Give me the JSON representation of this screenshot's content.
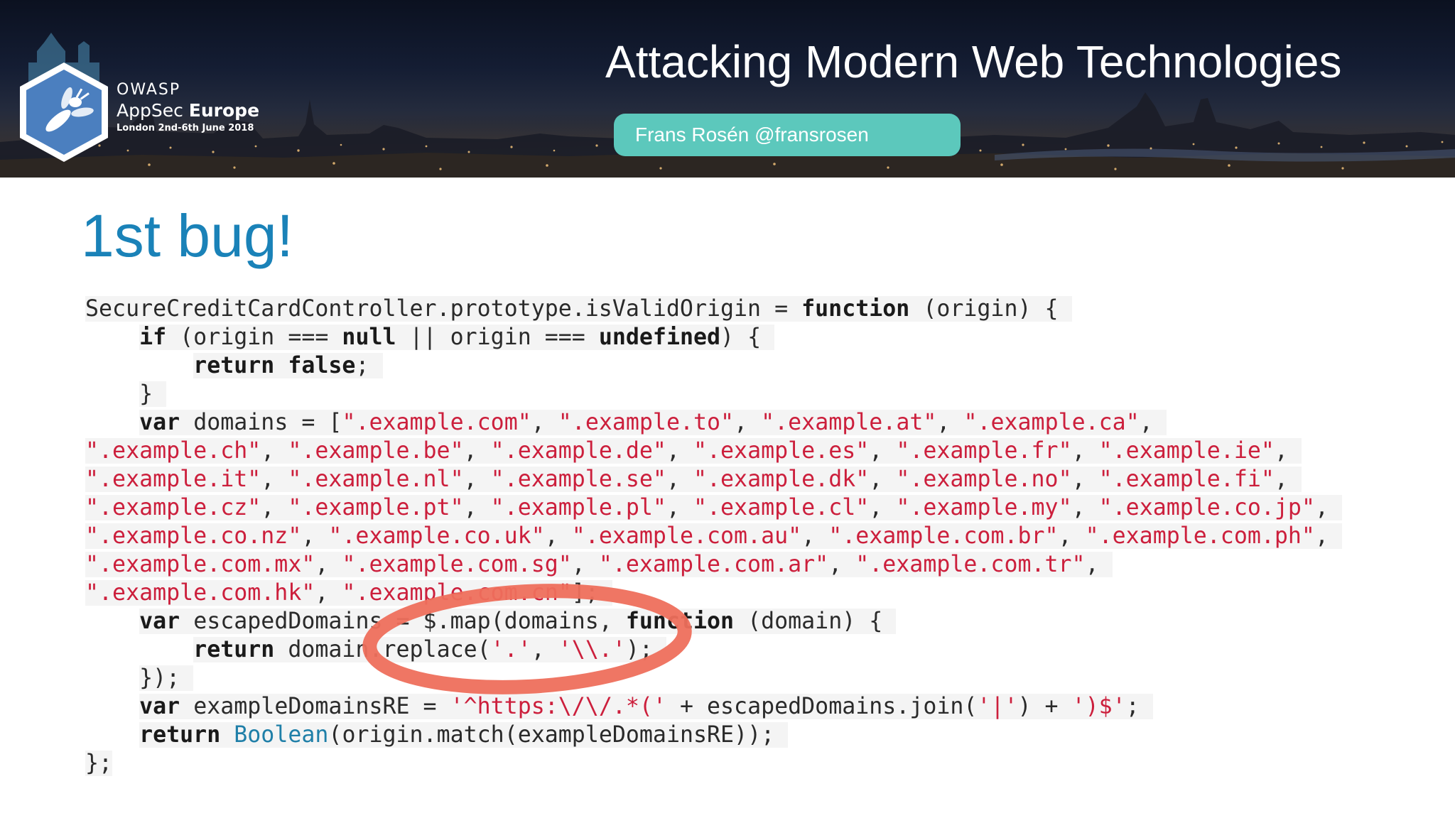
{
  "banner": {
    "owasp_name": "OWASP",
    "conference_prefix": "AppSec ",
    "conference_suffix": "Europe",
    "conference_date": "London 2nd-6th June 2018",
    "talk_title": "Attacking Modern Web Technologies",
    "speaker": "Frans Rosén @fransrosen"
  },
  "slide": {
    "heading": "1st bug!"
  },
  "code": {
    "lines": [
      {
        "indent": "",
        "tokens": [
          {
            "t": "SecureCreditCardController.prototype.isValidOrigin = ",
            "c": "plain"
          },
          {
            "t": "function",
            "c": "kw"
          },
          {
            "t": " (origin) { ",
            "c": "plain"
          }
        ]
      },
      {
        "indent": "    ",
        "tokens": [
          {
            "t": "if",
            "c": "kw"
          },
          {
            "t": " (origin === ",
            "c": "plain"
          },
          {
            "t": "null",
            "c": "kw"
          },
          {
            "t": " || origin === ",
            "c": "plain"
          },
          {
            "t": "undefined",
            "c": "kw"
          },
          {
            "t": ") { ",
            "c": "plain"
          }
        ]
      },
      {
        "indent": "        ",
        "tokens": [
          {
            "t": "return",
            "c": "kw"
          },
          {
            "t": " ",
            "c": "plain"
          },
          {
            "t": "false",
            "c": "kw"
          },
          {
            "t": "; ",
            "c": "plain"
          }
        ]
      },
      {
        "indent": "    ",
        "tokens": [
          {
            "t": "} ",
            "c": "plain"
          }
        ]
      },
      {
        "indent": "    ",
        "tokens": [
          {
            "t": "var",
            "c": "kw"
          },
          {
            "t": " domains = [",
            "c": "plain"
          },
          {
            "t": "\".example.com\"",
            "c": "str"
          },
          {
            "t": ", ",
            "c": "plain"
          },
          {
            "t": "\".example.to\"",
            "c": "str"
          },
          {
            "t": ", ",
            "c": "plain"
          },
          {
            "t": "\".example.at\"",
            "c": "str"
          },
          {
            "t": ", ",
            "c": "plain"
          },
          {
            "t": "\".example.ca\"",
            "c": "str"
          },
          {
            "t": ", ",
            "c": "plain"
          }
        ]
      },
      {
        "indent": "",
        "tokens": [
          {
            "t": "\".example.ch\"",
            "c": "str"
          },
          {
            "t": ", ",
            "c": "plain"
          },
          {
            "t": "\".example.be\"",
            "c": "str"
          },
          {
            "t": ", ",
            "c": "plain"
          },
          {
            "t": "\".example.de\"",
            "c": "str"
          },
          {
            "t": ", ",
            "c": "plain"
          },
          {
            "t": "\".example.es\"",
            "c": "str"
          },
          {
            "t": ", ",
            "c": "plain"
          },
          {
            "t": "\".example.fr\"",
            "c": "str"
          },
          {
            "t": ", ",
            "c": "plain"
          },
          {
            "t": "\".example.ie\"",
            "c": "str"
          },
          {
            "t": ", ",
            "c": "plain"
          }
        ]
      },
      {
        "indent": "",
        "tokens": [
          {
            "t": "\".example.it\"",
            "c": "str"
          },
          {
            "t": ", ",
            "c": "plain"
          },
          {
            "t": "\".example.nl\"",
            "c": "str"
          },
          {
            "t": ", ",
            "c": "plain"
          },
          {
            "t": "\".example.se\"",
            "c": "str"
          },
          {
            "t": ", ",
            "c": "plain"
          },
          {
            "t": "\".example.dk\"",
            "c": "str"
          },
          {
            "t": ", ",
            "c": "plain"
          },
          {
            "t": "\".example.no\"",
            "c": "str"
          },
          {
            "t": ", ",
            "c": "plain"
          },
          {
            "t": "\".example.fi\"",
            "c": "str"
          },
          {
            "t": ", ",
            "c": "plain"
          }
        ]
      },
      {
        "indent": "",
        "tokens": [
          {
            "t": "\".example.cz\"",
            "c": "str"
          },
          {
            "t": ", ",
            "c": "plain"
          },
          {
            "t": "\".example.pt\"",
            "c": "str"
          },
          {
            "t": ", ",
            "c": "plain"
          },
          {
            "t": "\".example.pl\"",
            "c": "str"
          },
          {
            "t": ", ",
            "c": "plain"
          },
          {
            "t": "\".example.cl\"",
            "c": "str"
          },
          {
            "t": ", ",
            "c": "plain"
          },
          {
            "t": "\".example.my\"",
            "c": "str"
          },
          {
            "t": ", ",
            "c": "plain"
          },
          {
            "t": "\".example.co.jp\"",
            "c": "str"
          },
          {
            "t": ", ",
            "c": "plain"
          }
        ]
      },
      {
        "indent": "",
        "tokens": [
          {
            "t": "\".example.co.nz\"",
            "c": "str"
          },
          {
            "t": ", ",
            "c": "plain"
          },
          {
            "t": "\".example.co.uk\"",
            "c": "str"
          },
          {
            "t": ", ",
            "c": "plain"
          },
          {
            "t": "\".example.com.au\"",
            "c": "str"
          },
          {
            "t": ", ",
            "c": "plain"
          },
          {
            "t": "\".example.com.br\"",
            "c": "str"
          },
          {
            "t": ", ",
            "c": "plain"
          },
          {
            "t": "\".example.com.ph\"",
            "c": "str"
          },
          {
            "t": ", ",
            "c": "plain"
          }
        ]
      },
      {
        "indent": "",
        "tokens": [
          {
            "t": "\".example.com.mx\"",
            "c": "str"
          },
          {
            "t": ", ",
            "c": "plain"
          },
          {
            "t": "\".example.com.sg\"",
            "c": "str"
          },
          {
            "t": ", ",
            "c": "plain"
          },
          {
            "t": "\".example.com.ar\"",
            "c": "str"
          },
          {
            "t": ", ",
            "c": "plain"
          },
          {
            "t": "\".example.com.tr\"",
            "c": "str"
          },
          {
            "t": ", ",
            "c": "plain"
          }
        ]
      },
      {
        "indent": "",
        "tokens": [
          {
            "t": "\".example.com.hk\"",
            "c": "str"
          },
          {
            "t": ", ",
            "c": "plain"
          },
          {
            "t": "\".example.com.cn\"",
            "c": "str"
          },
          {
            "t": "]; ",
            "c": "plain"
          }
        ]
      },
      {
        "indent": "    ",
        "tokens": [
          {
            "t": "var",
            "c": "kw"
          },
          {
            "t": " escapedDomains = $.map(domains, ",
            "c": "plain"
          },
          {
            "t": "function",
            "c": "kw"
          },
          {
            "t": " (domain) { ",
            "c": "plain"
          }
        ]
      },
      {
        "indent": "        ",
        "tokens": [
          {
            "t": "return",
            "c": "kw"
          },
          {
            "t": " domain.replace(",
            "c": "plain"
          },
          {
            "t": "'.'",
            "c": "str"
          },
          {
            "t": ", ",
            "c": "plain"
          },
          {
            "t": "'\\\\.'",
            "c": "str"
          },
          {
            "t": "); ",
            "c": "plain"
          }
        ]
      },
      {
        "indent": "    ",
        "tokens": [
          {
            "t": "}); ",
            "c": "plain"
          }
        ]
      },
      {
        "indent": "    ",
        "tokens": [
          {
            "t": "var",
            "c": "kw"
          },
          {
            "t": " exampleDomainsRE = ",
            "c": "plain"
          },
          {
            "t": "'^https:\\/\\/.*('",
            "c": "str"
          },
          {
            "t": " + escapedDomains.join(",
            "c": "plain"
          },
          {
            "t": "'|'",
            "c": "str"
          },
          {
            "t": ") + ",
            "c": "plain"
          },
          {
            "t": "')$'",
            "c": "str"
          },
          {
            "t": "; ",
            "c": "plain"
          }
        ]
      },
      {
        "indent": "    ",
        "tokens": [
          {
            "t": "return",
            "c": "kw"
          },
          {
            "t": " ",
            "c": "plain"
          },
          {
            "t": "Boolean",
            "c": "fn"
          },
          {
            "t": "(origin.match(exampleDomainsRE)); ",
            "c": "plain"
          }
        ]
      },
      {
        "indent": "",
        "tokens": [
          {
            "t": "};",
            "c": "plain"
          }
        ]
      }
    ]
  },
  "colors": {
    "heading": "#1a82b8",
    "speaker_pill": "#5cc8bc",
    "string_literal": "#cc1f3c",
    "builtin": "#1f7fa8",
    "highlight_ring": "#ee6f5c"
  }
}
